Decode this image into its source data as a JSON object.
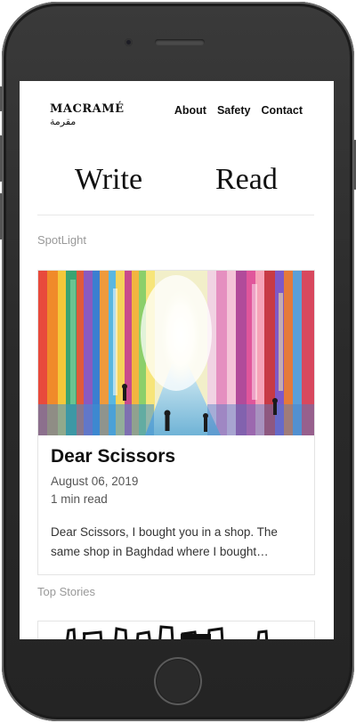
{
  "site": {
    "logo_title": "MACRAMÉ",
    "logo_subtitle": "مقرمة"
  },
  "nav": {
    "items": [
      {
        "label": "About"
      },
      {
        "label": "Safety"
      },
      {
        "label": "Contact"
      }
    ]
  },
  "hero": {
    "write_label": "Write",
    "read_label": "Read"
  },
  "spotlight": {
    "section_label": "SpotLight",
    "card": {
      "title": "Dear Scissors",
      "date": "August 06, 2019",
      "read_time": "1 min read",
      "excerpt": "Dear Scissors, I bought you in a shop. The same shop in Baghdad where I bought…"
    }
  },
  "top_stories": {
    "section_label": "Top Stories"
  },
  "colors": {
    "device_frame": "#2a2a2a",
    "text_primary": "#111111",
    "text_muted": "#999999",
    "divider": "#e8e8e8"
  }
}
